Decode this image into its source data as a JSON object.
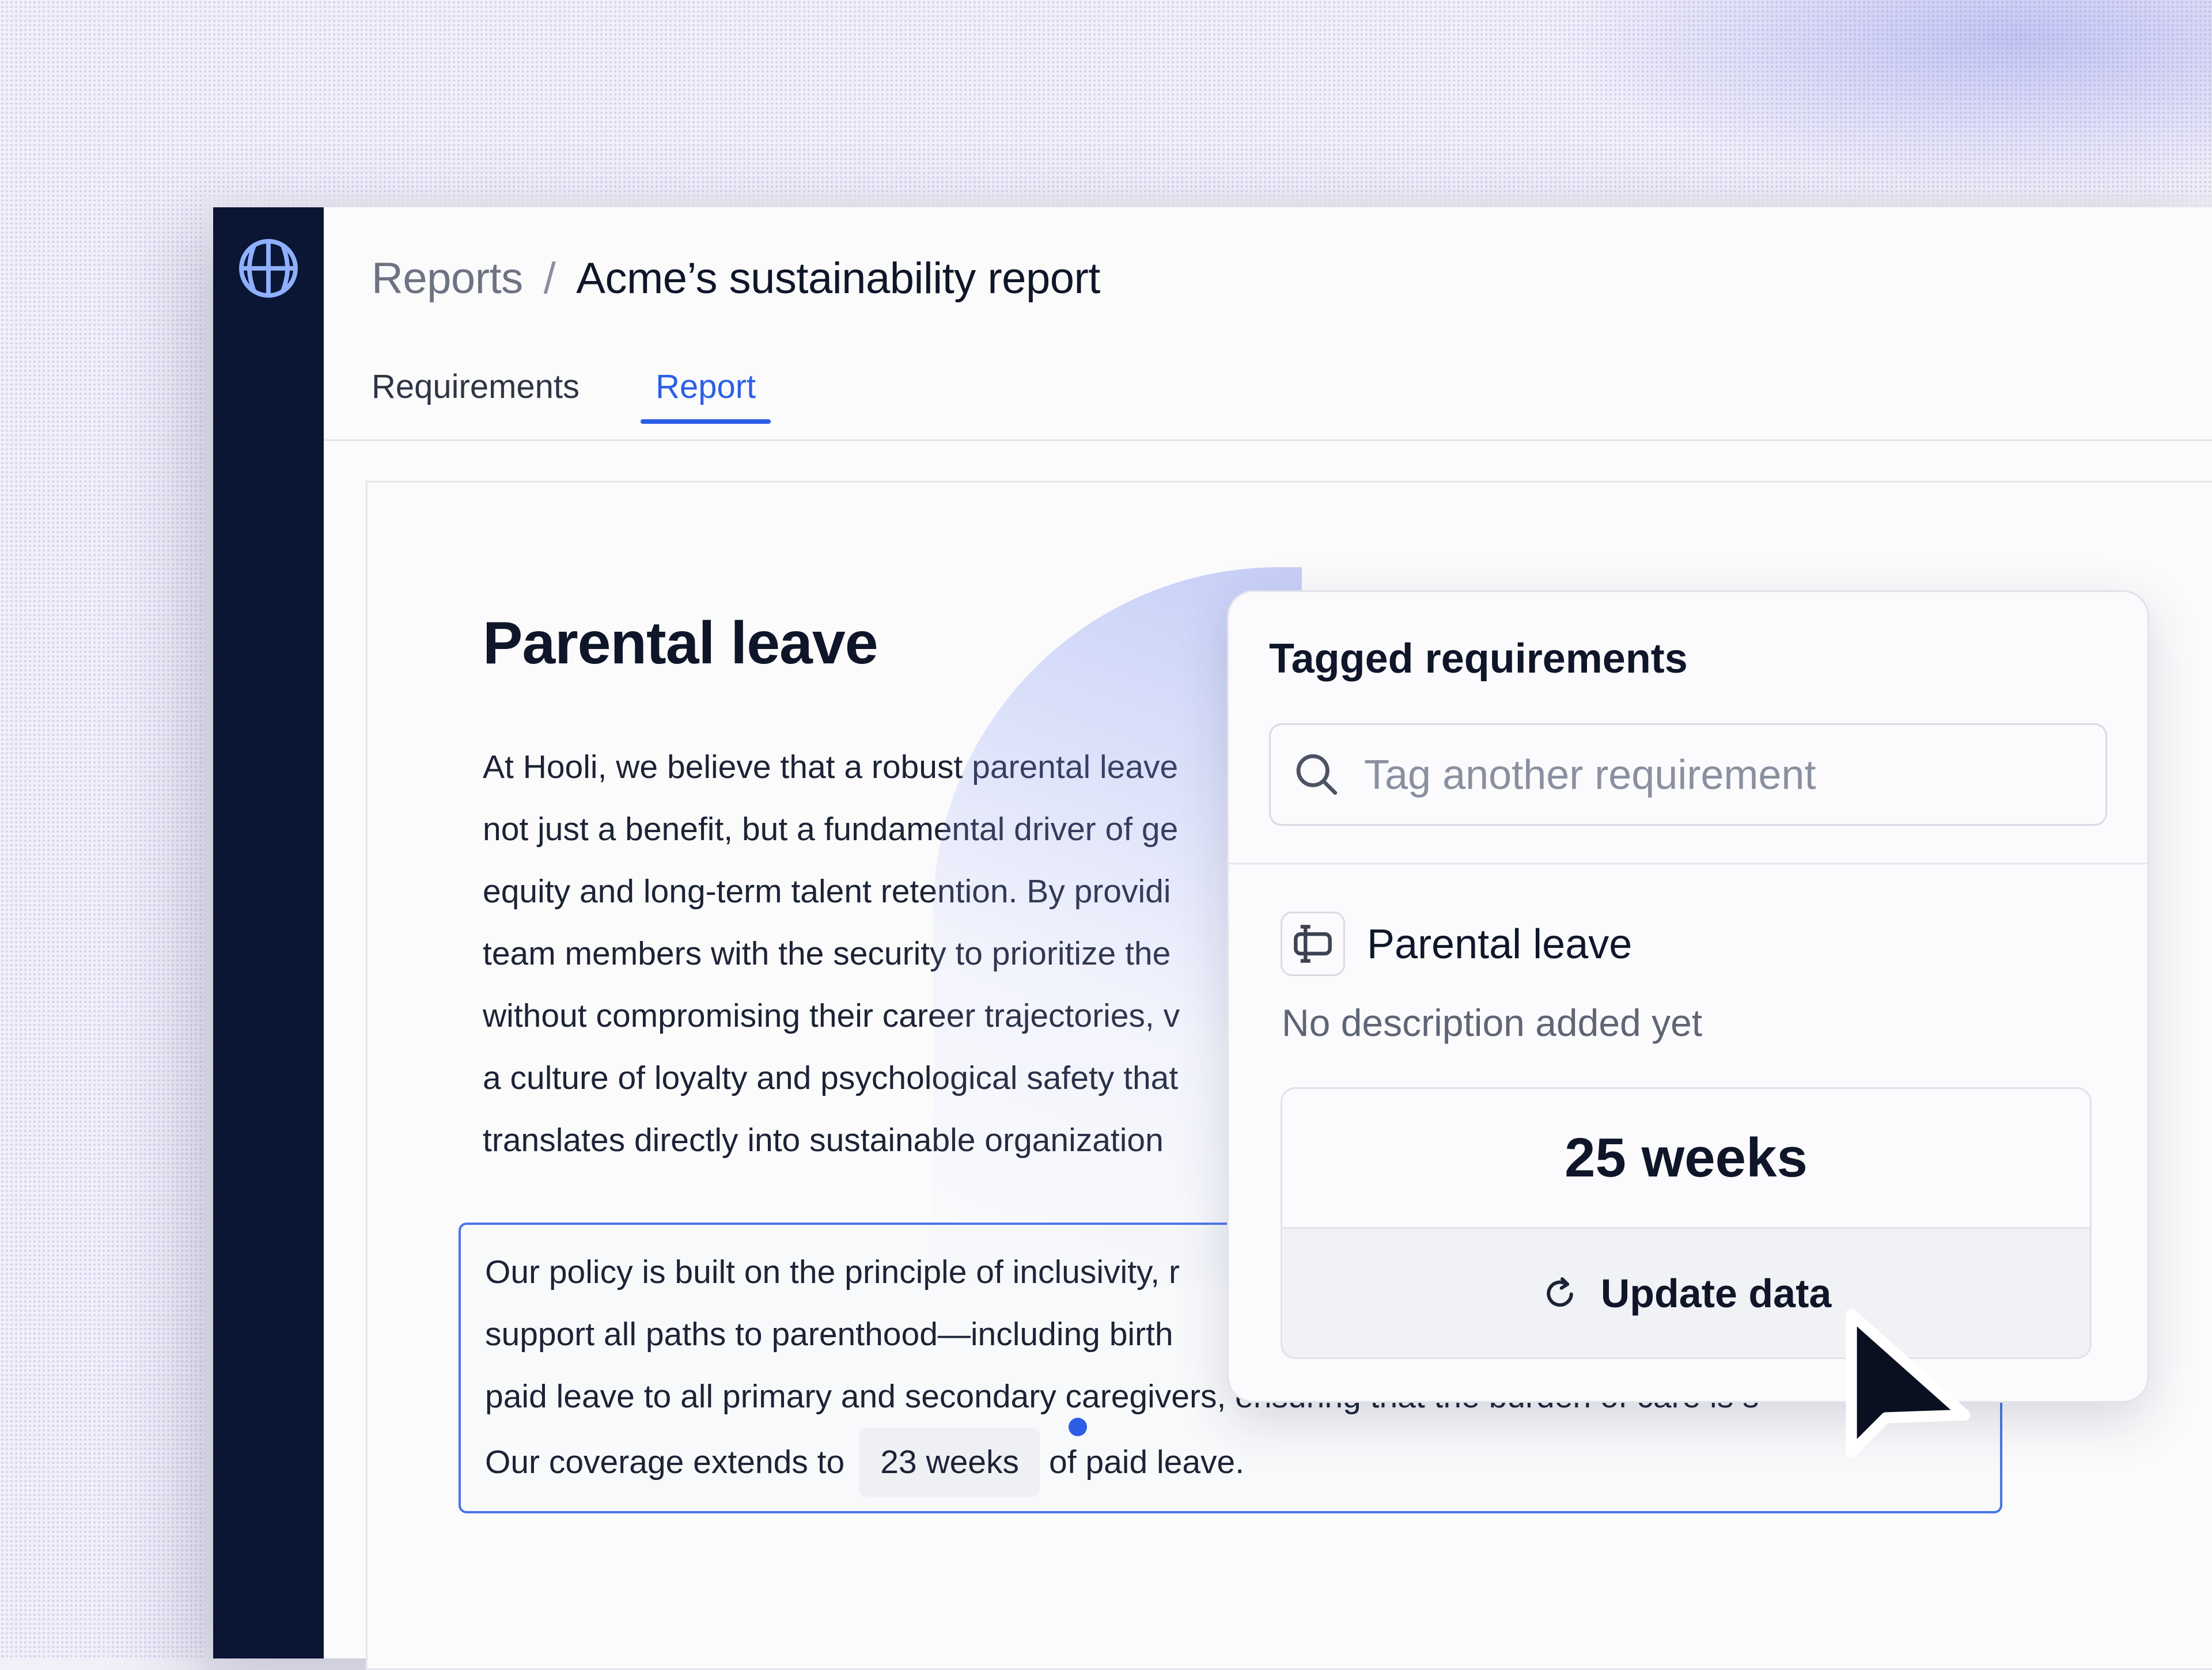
{
  "breadcrumb": {
    "parent": "Reports",
    "separator": "/",
    "current": "Acme’s sustainability report"
  },
  "tabs": [
    {
      "label": "Requirements",
      "active": false
    },
    {
      "label": "Report",
      "active": true
    }
  ],
  "document": {
    "title": "Parental leave",
    "paragraph1_lines": [
      "At Hooli, we believe that a robust parental leave",
      "not just a benefit, but a fundamental driver of ge",
      "equity and long-term talent retention. By providi",
      "team members with the security to prioritize the",
      "without compromising their career trajectories, v",
      "a culture of loyalty and psychological safety that",
      "translates directly into sustainable organization"
    ],
    "paragraph2_lines": [
      "Our policy is built on the principle of inclusivity, r",
      "support all paths to parenthood—including birth",
      "paid leave to all primary and secondary caregivers, ensuring that the burden of care is s"
    ],
    "coverage_prefix": "Our coverage extends to",
    "coverage_value": "23 weeks",
    "coverage_suffix": "of paid leave."
  },
  "popup": {
    "title": "Tagged requirements",
    "search_placeholder": "Tag another requirement",
    "requirement": {
      "name": "Parental leave",
      "description": "No description added yet",
      "value": "25 weeks",
      "update_label": "Update data"
    }
  },
  "icons": {
    "logo": "globe-logo-icon",
    "search": "search-icon",
    "requirement": "requirement-tag-icon",
    "refresh": "refresh-icon",
    "cursor": "mouse-pointer-icon"
  },
  "colors": {
    "sidebar": "#0b1634",
    "accent": "#2c5fe6",
    "text_primary": "#0f1629",
    "text_muted": "#6d7382"
  }
}
